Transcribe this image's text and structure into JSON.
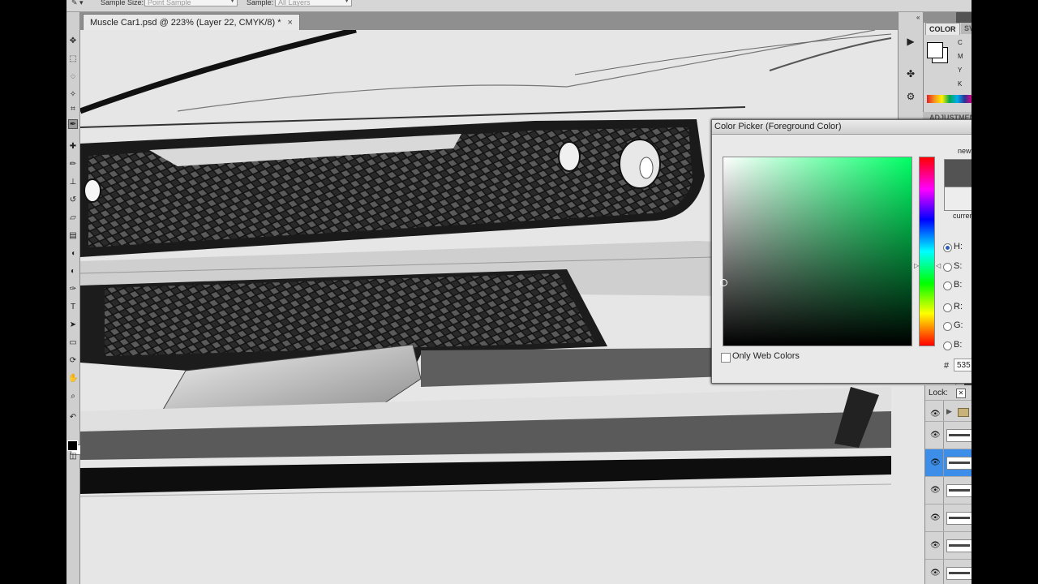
{
  "options_bar": {
    "sample_size_label": "Sample Size:",
    "sample_size_value": "Point Sample",
    "sample_label": "Sample:",
    "sample_value": "All Layers"
  },
  "document": {
    "tab_title": "Muscle Car1.psd @ 223% (Layer 22, CMYK/8) *",
    "close_glyph": "×"
  },
  "color_panel": {
    "tab_color": "COLOR",
    "tab_swatches": "SV",
    "channels": [
      "C",
      "M",
      "Y",
      "K"
    ],
    "adjustments_tab": "ADJUSTMENT"
  },
  "layers_panel": {
    "lock_label": "Lock:"
  },
  "color_picker": {
    "title": "Color Picker (Foreground Color)",
    "new_label": "new",
    "current_label": "current",
    "fields": [
      {
        "label": "H:",
        "selected": true
      },
      {
        "label": "S:",
        "selected": false
      },
      {
        "label": "B:",
        "selected": false
      },
      {
        "label": "R:",
        "selected": false
      },
      {
        "label": "G:",
        "selected": false
      },
      {
        "label": "B:",
        "selected": false
      }
    ],
    "only_web_colors": "Only Web Colors",
    "hash": "#",
    "hex_value": "535",
    "new_color": "#535353",
    "current_color": "#ededed"
  },
  "icons": {
    "eye": "eye-icon",
    "collapse": "double-chevron-icon",
    "play": "play-icon",
    "brush_settings": "brush-settings-icon",
    "clone_source": "clone-source-icon"
  },
  "colors": {
    "app_bg": "#535353",
    "selection_blue": "#3d8ee8"
  }
}
